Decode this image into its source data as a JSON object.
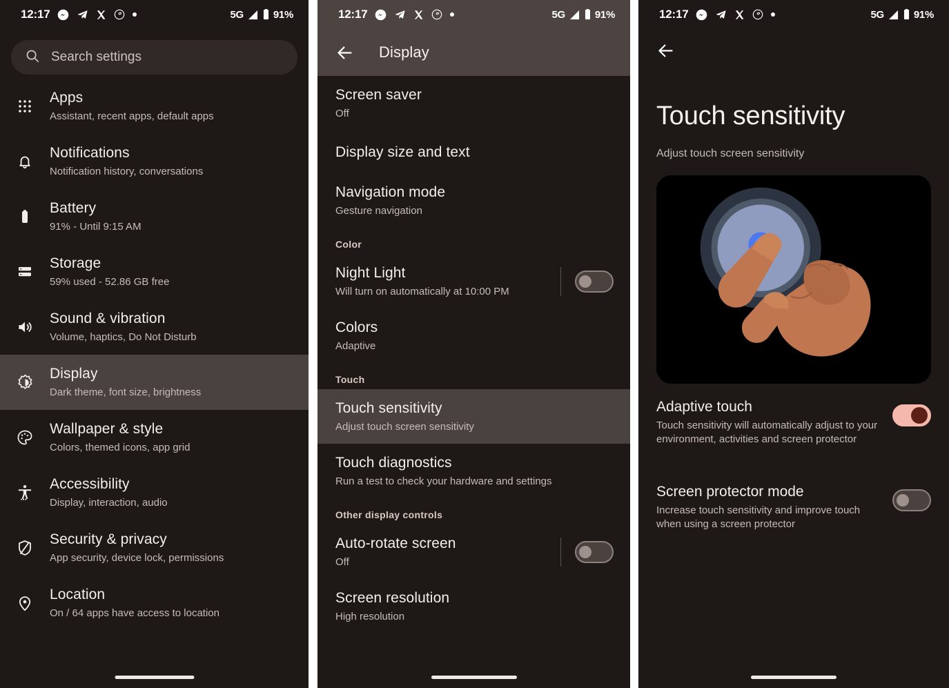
{
  "status_bar": {
    "time": "12:17",
    "icons": [
      "messenger-icon",
      "telegram-icon",
      "x-icon",
      "threads-icon",
      "dot-icon"
    ],
    "network": "5G",
    "battery_percent": "91%"
  },
  "panel1": {
    "name": "settings-home",
    "search": {
      "placeholder": "Search settings",
      "icon": "search-icon"
    },
    "items": [
      {
        "icon": "apps-grid-icon",
        "title": "Apps",
        "subtitle": "Assistant, recent apps, default apps",
        "selected": false
      },
      {
        "icon": "bell-icon",
        "title": "Notifications",
        "subtitle": "Notification history, conversations",
        "selected": false
      },
      {
        "icon": "battery-icon",
        "title": "Battery",
        "subtitle": "91% - Until 9:15 AM",
        "selected": false
      },
      {
        "icon": "storage-icon",
        "title": "Storage",
        "subtitle": "59% used - 52.86 GB free",
        "selected": false
      },
      {
        "icon": "sound-icon",
        "title": "Sound & vibration",
        "subtitle": "Volume, haptics, Do Not Disturb",
        "selected": false
      },
      {
        "icon": "brightness-icon",
        "title": "Display",
        "subtitle": "Dark theme, font size, brightness",
        "selected": true
      },
      {
        "icon": "palette-icon",
        "title": "Wallpaper & style",
        "subtitle": "Colors, themed icons, app grid",
        "selected": false
      },
      {
        "icon": "accessibility-icon",
        "title": "Accessibility",
        "subtitle": "Display, interaction, audio",
        "selected": false
      },
      {
        "icon": "shield-icon",
        "title": "Security & privacy",
        "subtitle": "App security, device lock, permissions",
        "selected": false
      },
      {
        "icon": "location-pin-icon",
        "title": "Location",
        "subtitle": "On / 64 apps have access to location",
        "selected": false
      }
    ]
  },
  "panel2": {
    "name": "display-settings",
    "appbar": {
      "back_icon": "back-arrow-icon",
      "title": "Display"
    },
    "items": [
      {
        "type": "pref",
        "title": "Screen saver",
        "subtitle": "Off",
        "selected": false
      },
      {
        "type": "pref",
        "title": "Display size and text",
        "subtitle": "",
        "selected": false
      },
      {
        "type": "pref",
        "title": "Navigation mode",
        "subtitle": "Gesture navigation",
        "selected": false
      },
      {
        "type": "section",
        "title": "Color"
      },
      {
        "type": "toggle",
        "title": "Night Light",
        "subtitle": "Will turn on automatically at 10:00 PM",
        "toggle_state": "off",
        "selected": false
      },
      {
        "type": "pref",
        "title": "Colors",
        "subtitle": "Adaptive",
        "selected": false
      },
      {
        "type": "section",
        "title": "Touch"
      },
      {
        "type": "pref",
        "title": "Touch sensitivity",
        "subtitle": "Adjust touch screen sensitivity",
        "selected": true
      },
      {
        "type": "pref",
        "title": "Touch diagnostics",
        "subtitle": "Run a test to check your hardware and settings",
        "selected": false
      },
      {
        "type": "section",
        "title": "Other display controls"
      },
      {
        "type": "toggle",
        "title": "Auto-rotate screen",
        "subtitle": "Off",
        "toggle_state": "off",
        "selected": false
      },
      {
        "type": "pref",
        "title": "Screen resolution",
        "subtitle": "High resolution",
        "selected": false
      }
    ]
  },
  "panel3": {
    "name": "touch-sensitivity-settings",
    "appbar": {
      "back_icon": "back-arrow-icon"
    },
    "title": "Touch sensitivity",
    "subtitle": "Adjust touch screen sensitivity",
    "illustration": "finger-tapping-screen-illustration",
    "items": [
      {
        "title": "Adaptive touch",
        "subtitle": "Touch sensitivity will automatically adjust to your environment, activities and screen protector",
        "toggle_state": "on"
      },
      {
        "title": "Screen protector mode",
        "subtitle": "Increase touch sensitivity and improve touch when using a screen protector",
        "toggle_state": "off"
      }
    ]
  },
  "colors": {
    "background": "#1e1817",
    "selected_row": "#4a4240",
    "appbar": "#4d4441",
    "toggle_on": "#f4b8ac",
    "toggle_on_knob": "#5c2019",
    "accent_text": "#dcc9c4"
  }
}
